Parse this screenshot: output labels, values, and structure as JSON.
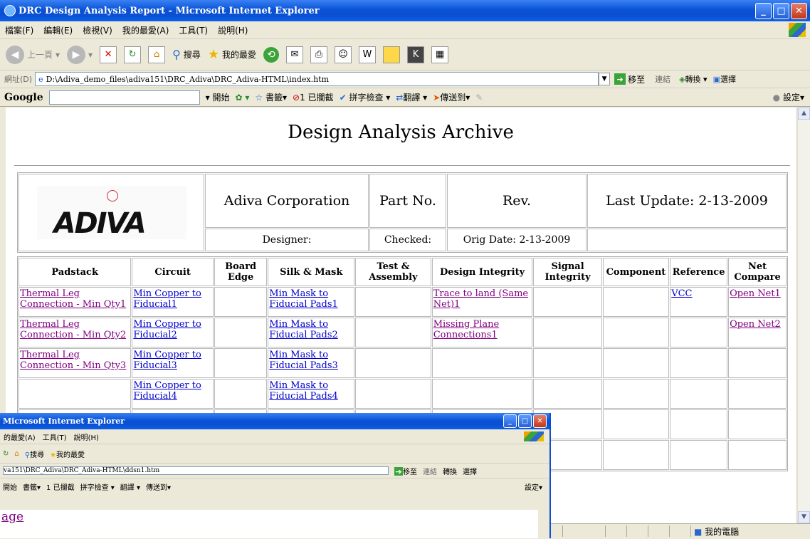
{
  "window": {
    "title": "DRC Design Analysis Report - Microsoft Internet Explorer",
    "menu": [
      "檔案(F)",
      "編輯(E)",
      "檢視(V)",
      "我的最愛(A)",
      "工具(T)",
      "說明(H)"
    ]
  },
  "toolbar": {
    "back": "上一頁",
    "search": "搜尋",
    "favorites": "我的最愛"
  },
  "address": {
    "label": "網址(D)",
    "value": "D:\\Adiva_demo_files\\adiva151\\DRC_Adiva\\DRC_Adiva-HTML\\index.htm",
    "go": "移至",
    "links": "連結",
    "convert": "轉換",
    "select": "選擇"
  },
  "google_bar": {
    "logo": "Google",
    "start": "開始",
    "bookmarks": "書籤▾",
    "blocked": "1 已攔截",
    "spell": "拼字檢查 ▾",
    "translate": "翻譯 ▾",
    "send": "傳送到▾",
    "settings": "設定▾"
  },
  "page": {
    "title": "Design Analysis Archive",
    "logo_text": "ADIVA",
    "company": "Adiva Corporation",
    "part_no": "Part No.",
    "rev": "Rev.",
    "last_update": "Last Update: 2-13-2009",
    "designer": "Designer:",
    "checked": "Checked:",
    "orig_date": "Orig Date: 2-13-2009"
  },
  "grid": {
    "headers": [
      "Padstack",
      "Circuit",
      "Board Edge",
      "Silk & Mask",
      "Test & Assembly",
      "Design Integrity",
      "Signal Integrity",
      "Component",
      "Reference",
      "Net Compare"
    ],
    "rows": [
      [
        "Thermal Leg Connection - Min Qty1",
        "Min Copper to Fiducial1",
        "",
        "Min Mask to Fiducial Pads1",
        "",
        "Trace to land (Same Net)1",
        "",
        "",
        "VCC",
        "Open Net1"
      ],
      [
        "Thermal Leg Connection - Min Qty2",
        "Min Copper to Fiducial2",
        "",
        "Min Mask to Fiducial Pads2",
        "",
        "Missing Plane Connections1",
        "",
        "",
        "",
        "Open Net2"
      ],
      [
        "Thermal Leg Connection - Min Qty3",
        "Min Copper to Fiducial3",
        "",
        "Min Mask to Fiducial Pads3",
        "",
        "",
        "",
        "",
        "",
        ""
      ],
      [
        "",
        "Min Copper to Fiducial4",
        "",
        "Min Mask to Fiducial Pads4",
        "",
        "",
        "",
        "",
        "",
        ""
      ],
      [
        "",
        "",
        "",
        "",
        "",
        "",
        "",
        "",
        "",
        ""
      ],
      [
        "",
        "",
        "",
        "",
        "",
        "",
        "",
        "",
        "",
        ""
      ]
    ]
  },
  "status": {
    "zone": "我的電腦"
  },
  "popup": {
    "title": "Microsoft Internet Explorer",
    "menu": [
      "的最愛(A)",
      "工具(T)",
      "說明(H)"
    ],
    "address": "va151\\DRC_Adiva\\DRC_Adiva-HTML\\ddsn1.htm",
    "go": "移至",
    "links": "連結",
    "convert": "轉換",
    "select": "選擇",
    "settings": "設定▾",
    "link": "age"
  }
}
